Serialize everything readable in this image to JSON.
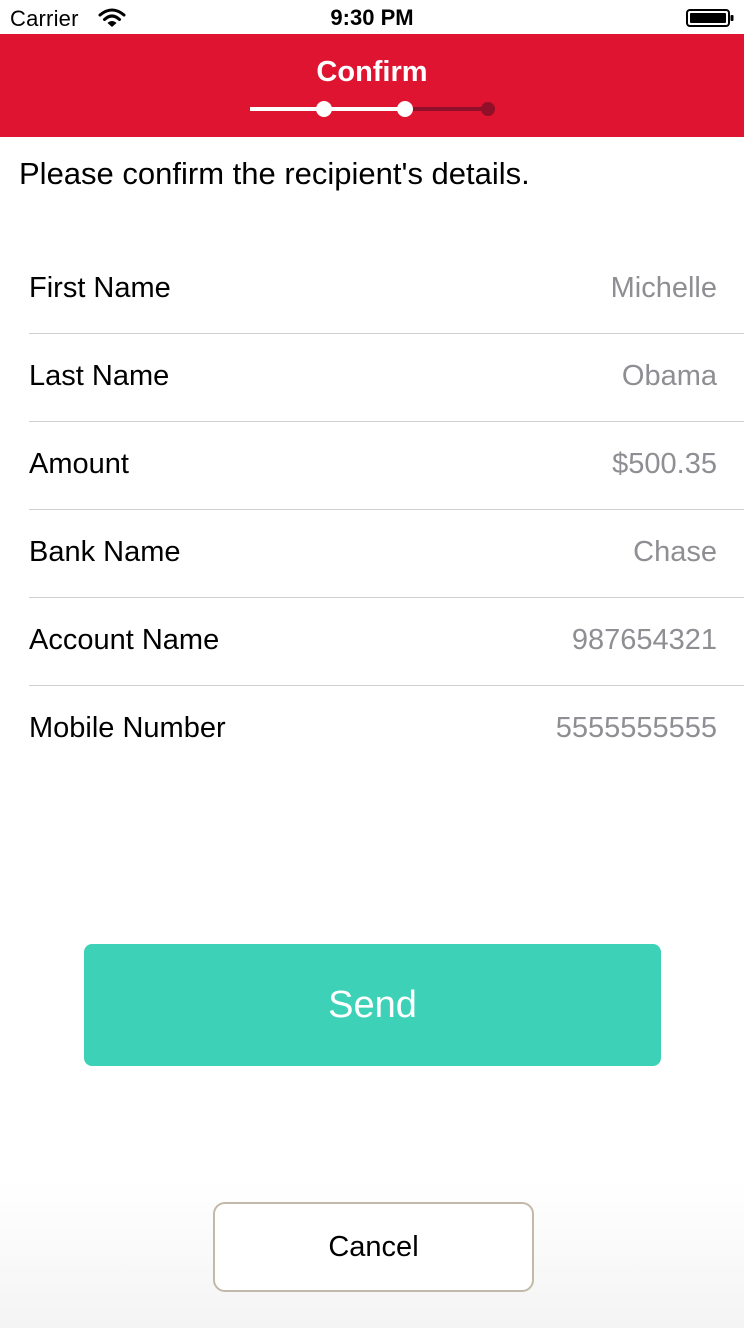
{
  "status_bar": {
    "carrier": "Carrier",
    "time": "9:30 PM",
    "wifi_icon": "wifi-icon",
    "battery_icon": "battery-icon"
  },
  "header": {
    "title": "Confirm",
    "background_color": "#de1431",
    "progress": {
      "total_steps": 3,
      "current_step": 3,
      "completed_color": "#ffffff",
      "remaining_color": "#8f1028"
    }
  },
  "instruction": "Please confirm the recipient's details.",
  "details": [
    {
      "label": "First Name",
      "value": "Michelle"
    },
    {
      "label": "Last Name",
      "value": "Obama"
    },
    {
      "label": "Amount",
      "value": "$500.35"
    },
    {
      "label": "Bank Name",
      "value": "Chase"
    },
    {
      "label": "Account Name",
      "value": "987654321"
    },
    {
      "label": "Mobile Number",
      "value": "5555555555"
    }
  ],
  "actions": {
    "send_label": "Send",
    "send_color": "#3dd2b7",
    "cancel_label": "Cancel"
  }
}
